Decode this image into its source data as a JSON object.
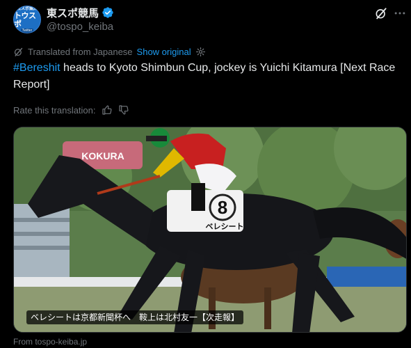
{
  "author": {
    "display_name": "東スポ競馬",
    "handle": "@tospo_keiba",
    "avatar_text_top": "東スポ競馬",
    "avatar_text_main": "トウスポ",
    "avatar_text_bottom": "Twitter",
    "verified_icon": "verified-badge-icon"
  },
  "translation": {
    "translated_from": "Translated from Japanese",
    "show_original": "Show original"
  },
  "tweet": {
    "hashtag": "#Bereshit",
    "text_rest": " heads to Kyoto Shimbun Cup, jockey is Yuichi Kitamura [Next Race Report]"
  },
  "rate": {
    "label": "Rate this translation:"
  },
  "media": {
    "sign_text": "KOKURA",
    "saddle_number": "8",
    "saddle_name": "ベレシート",
    "caption": "ベレシートは京都新聞杯へ　鞍上は北村友一【次走報】",
    "alt": "Bereshit racing"
  },
  "link": {
    "source": "From tospo-keiba.jp"
  },
  "colors": {
    "background": "#000000",
    "text": "#e7e9ea",
    "muted": "#71767b",
    "accent": "#1d9bf0"
  }
}
